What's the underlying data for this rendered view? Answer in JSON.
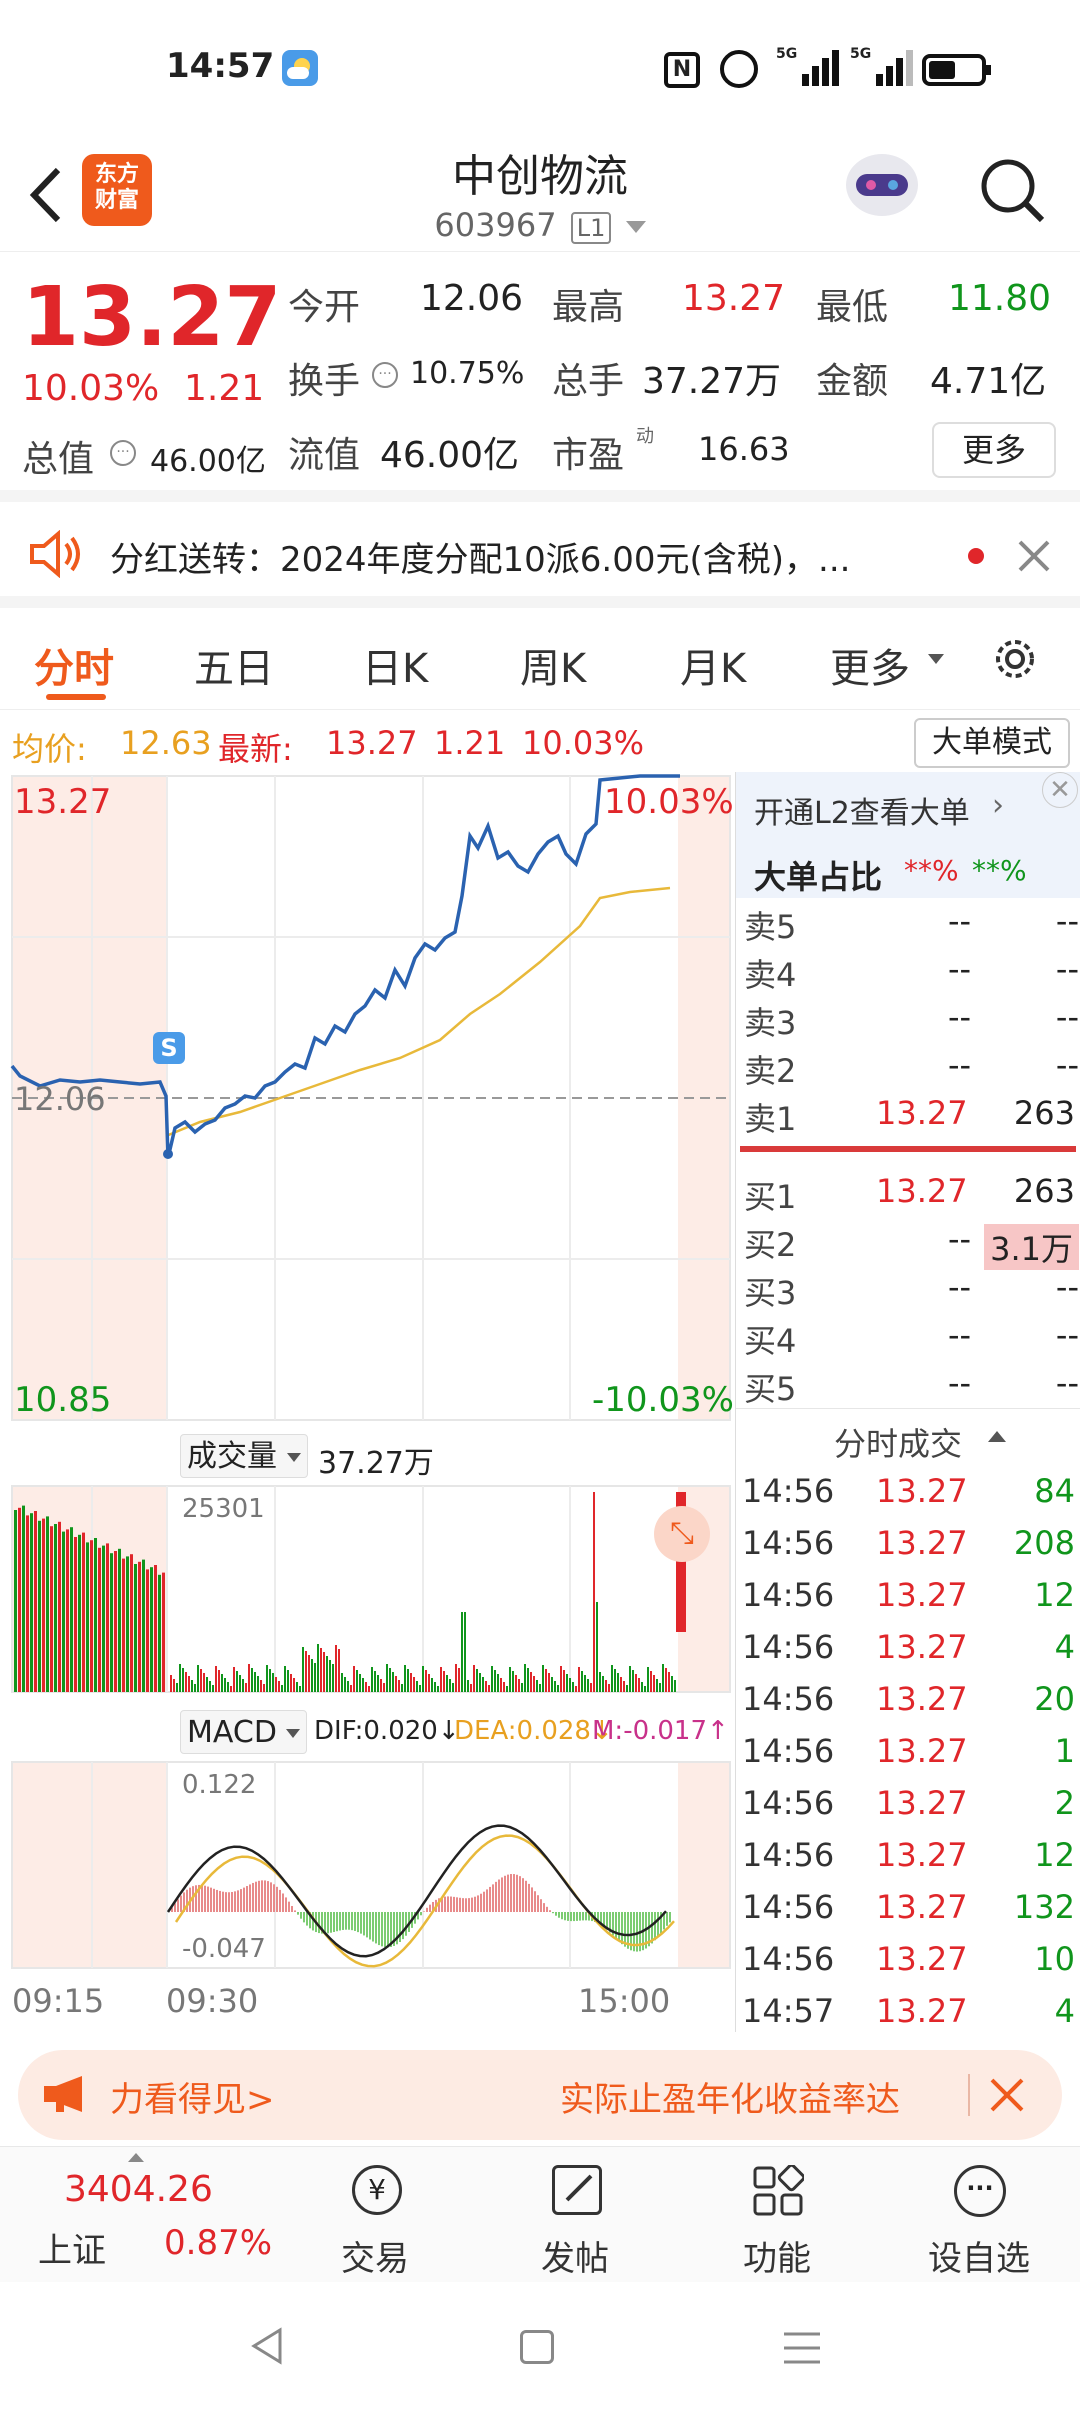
{
  "status": {
    "time": "14:57",
    "network1": "5G",
    "network2": "5G"
  },
  "header": {
    "brand_line1": "东方",
    "brand_line2": "财富",
    "stock_name": "中创物流",
    "stock_code": "603967",
    "level": "L1"
  },
  "quote": {
    "price": "13.27",
    "change_pct": "10.03%",
    "change": "1.21",
    "open_label": "今开",
    "open": "12.06",
    "high_label": "最高",
    "high": "13.27",
    "low_label": "最低",
    "low": "11.80",
    "turnover_label": "换手",
    "turnover": "10.75%",
    "volume_label": "总手",
    "volume": "37.27万",
    "amount_label": "金额",
    "amount": "4.71亿",
    "mcap_label": "总值",
    "mcap": "46.00亿",
    "float_label": "流值",
    "float": "46.00亿",
    "pe_label": "市盈",
    "pe_sup": "动",
    "pe": "16.63",
    "more_label": "更多"
  },
  "notice": {
    "text": "分红送转：2024年度分配10派6.00元(含税)，..."
  },
  "tabs": [
    {
      "label": "分时",
      "active": true
    },
    {
      "label": "五日"
    },
    {
      "label": "日K"
    },
    {
      "label": "周K"
    },
    {
      "label": "月K"
    },
    {
      "label": "更多"
    }
  ],
  "infobar": {
    "avg_label": "均价:",
    "avg": "12.63",
    "latest_label": "最新:",
    "latest": "13.27",
    "chg": "1.21",
    "pct": "10.03%",
    "big_order_mode": "大单模式"
  },
  "chart": {
    "max_price": "13.27",
    "max_pct": "10.03%",
    "min_price": "10.85",
    "min_pct": "-10.03%",
    "ref_price": "12.06",
    "s_marker": "S",
    "vol_label": "成交量",
    "vol_total": "37.27万",
    "vol_max": "25301",
    "macd_label": "MACD",
    "dif": "DIF:0.020↓",
    "dea": "DEA:0.028↓",
    "m": "M:-0.017↑",
    "macd_max": "0.122",
    "macd_min": "-0.047",
    "time_start": "09:15",
    "time_open": "09:30",
    "time_end": "15:00",
    "colors": {
      "price_line": "#2a62b0",
      "avg_line": "#e8b93a",
      "up": "#e0262a",
      "down": "#10951c"
    }
  },
  "orderbook": {
    "l2_label": "开通L2查看大单",
    "big_ratio_label": "大单占比",
    "big_ratio_red": "**%",
    "big_ratio_green": "**%",
    "asks": [
      {
        "label": "卖5",
        "price": "--",
        "vol": "--"
      },
      {
        "label": "卖4",
        "price": "--",
        "vol": "--"
      },
      {
        "label": "卖3",
        "price": "--",
        "vol": "--"
      },
      {
        "label": "卖2",
        "price": "--",
        "vol": "--"
      },
      {
        "label": "卖1",
        "price": "13.27",
        "vol": "263"
      }
    ],
    "bids": [
      {
        "label": "买1",
        "price": "13.27",
        "vol": "263"
      },
      {
        "label": "买2",
        "price": "--",
        "vol": "3.1万"
      },
      {
        "label": "买3",
        "price": "--",
        "vol": "--"
      },
      {
        "label": "买4",
        "price": "--",
        "vol": "--"
      },
      {
        "label": "买5",
        "price": "--",
        "vol": "--"
      }
    ],
    "ticks_label": "分时成交",
    "ticks": [
      {
        "time": "14:56",
        "price": "13.27",
        "vol": "84"
      },
      {
        "time": "14:56",
        "price": "13.27",
        "vol": "208"
      },
      {
        "time": "14:56",
        "price": "13.27",
        "vol": "12"
      },
      {
        "time": "14:56",
        "price": "13.27",
        "vol": "4"
      },
      {
        "time": "14:56",
        "price": "13.27",
        "vol": "20"
      },
      {
        "time": "14:56",
        "price": "13.27",
        "vol": "1"
      },
      {
        "time": "14:56",
        "price": "13.27",
        "vol": "2"
      },
      {
        "time": "14:56",
        "price": "13.27",
        "vol": "12"
      },
      {
        "time": "14:56",
        "price": "13.27",
        "vol": "132"
      },
      {
        "time": "14:56",
        "price": "13.27",
        "vol": "10"
      },
      {
        "time": "14:57",
        "price": "13.27",
        "vol": "4"
      }
    ]
  },
  "promo": {
    "left": "力看得见>",
    "right": "实际止盈年化收益率达"
  },
  "bottom": {
    "index_value": "3404.26",
    "index_name": "上证",
    "index_pct": "0.87%",
    "items": [
      {
        "label": "交易"
      },
      {
        "label": "发帖"
      },
      {
        "label": "功能"
      },
      {
        "label": "设自选"
      }
    ]
  }
}
